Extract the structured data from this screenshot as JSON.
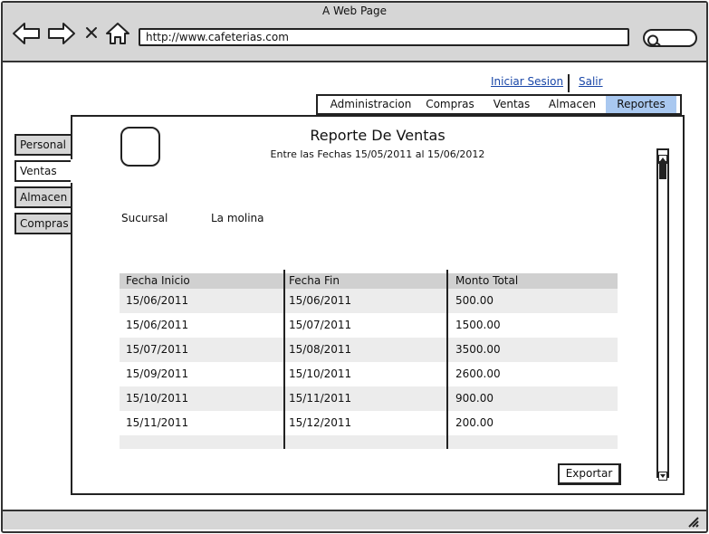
{
  "browser": {
    "title": "A Web Page",
    "url": "http://www.cafeterias.com"
  },
  "top_links": {
    "login": "Iniciar Sesion",
    "logout": "Salir"
  },
  "menu": {
    "items": [
      {
        "label": "Administracion"
      },
      {
        "label": "Compras"
      },
      {
        "label": "Ventas"
      },
      {
        "label": "Almacen"
      },
      {
        "label": "Reportes"
      }
    ],
    "active": "Reportes"
  },
  "sidebar": {
    "items": [
      {
        "label": "Personal"
      },
      {
        "label": "Ventas"
      },
      {
        "label": "Almacen"
      },
      {
        "label": "Compras"
      }
    ],
    "active": "Ventas"
  },
  "report": {
    "title": "Reporte De Ventas",
    "subtitle": "Entre las Fechas  15/05/2011 al 15/06/2012",
    "sucursal_label": "Sucursal",
    "sucursal_value": "La molina",
    "columns": [
      "Fecha Inicio",
      "Fecha Fin",
      "Monto Total"
    ],
    "rows": [
      [
        "15/06/2011",
        "15/06/2011",
        "500.00"
      ],
      [
        "15/06/2011",
        "15/07/2011",
        "1500.00"
      ],
      [
        "15/07/2011",
        "15/08/2011",
        "3500.00"
      ],
      [
        "15/09/2011",
        "15/10/2011",
        "2600.00"
      ],
      [
        "15/10/2011",
        "15/11/2011",
        "900.00"
      ],
      [
        "15/11/2011",
        "15/12/2011",
        "200.00"
      ]
    ],
    "export_label": "Exportar"
  }
}
